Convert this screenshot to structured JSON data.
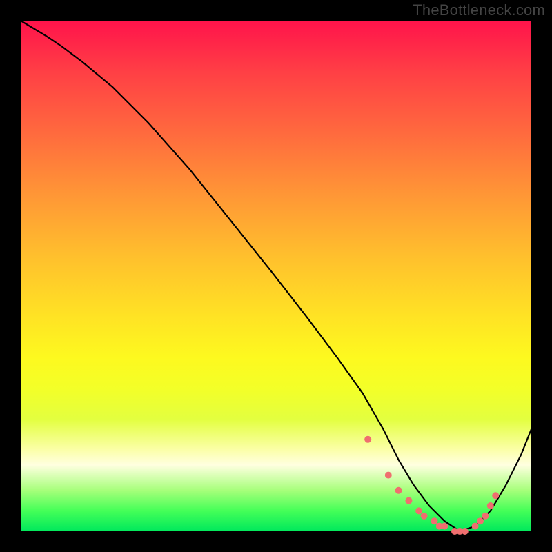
{
  "watermark": "TheBottleneck.com",
  "colors": {
    "dot": "#ef6f6f",
    "curve": "#000000"
  },
  "chart_data": {
    "type": "line",
    "title": "",
    "xlabel": "",
    "ylabel": "",
    "xlim": [
      0,
      100
    ],
    "ylim": [
      0,
      100
    ],
    "grid": false,
    "curve": {
      "x": [
        0,
        5,
        8,
        12,
        18,
        25,
        33,
        41,
        49,
        56,
        62,
        67,
        71,
        74,
        77,
        80,
        83,
        86,
        89,
        92,
        95,
        98,
        100
      ],
      "y": [
        100,
        97,
        95,
        92,
        87,
        80,
        71,
        61,
        51,
        42,
        34,
        27,
        20,
        14,
        9,
        5,
        2,
        0,
        1,
        4,
        9,
        15,
        20
      ]
    },
    "markers": {
      "x": [
        68,
        72,
        74,
        76,
        78,
        79,
        81,
        82,
        83,
        85,
        86,
        87,
        89,
        90,
        91,
        92,
        93
      ],
      "y": [
        18,
        11,
        8,
        6,
        4,
        3,
        2,
        1,
        1,
        0,
        0,
        0,
        1,
        2,
        3,
        5,
        7
      ]
    }
  }
}
